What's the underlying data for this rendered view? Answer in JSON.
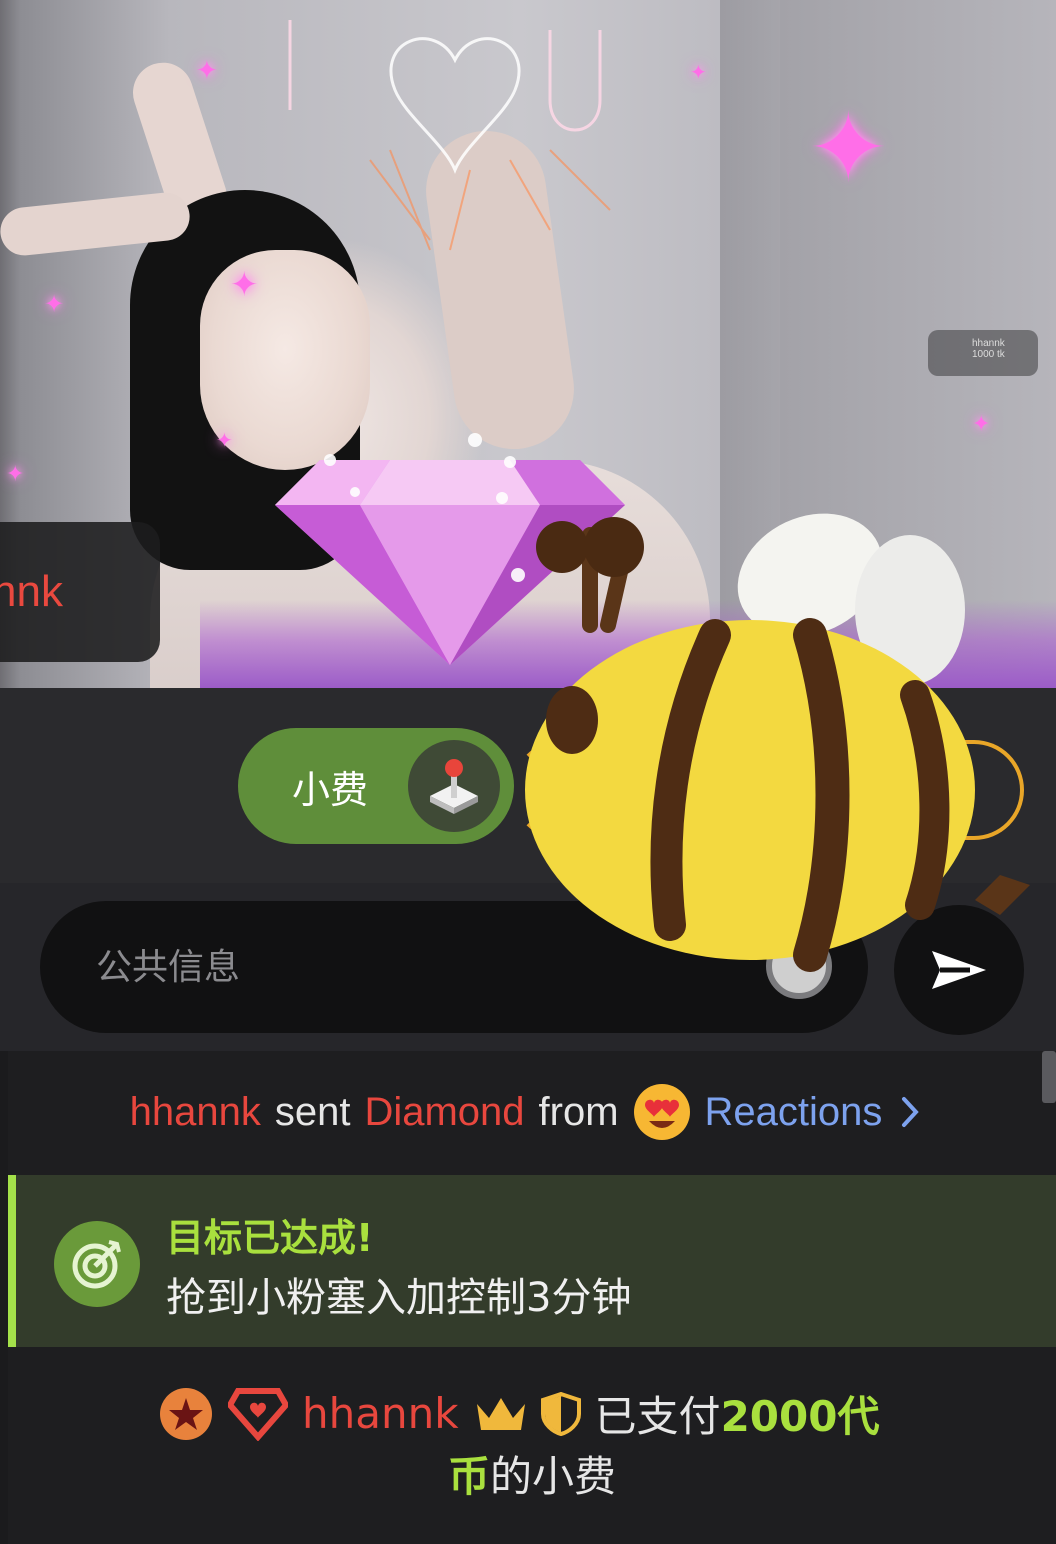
{
  "stream": {
    "user_tag_fragment": "nnk",
    "mini_card": {
      "user": "hhannk",
      "line2": "1000 tk"
    }
  },
  "controls": {
    "tip_button_label": "小费",
    "icons": {
      "tip_button": "joystick-icon",
      "send": "send-arrow-icon",
      "emoji": "emoji-icon"
    }
  },
  "composer": {
    "placeholder": "公共信息"
  },
  "feed": {
    "gift_message": {
      "user": "hhannk",
      "verb": "sent",
      "gift": "Diamond",
      "from_word": "from",
      "source": "Reactions",
      "source_icon": "heart-eyes-emoji-icon",
      "chevron_icon": "chevron-right-icon"
    },
    "goal_message": {
      "title": "目标已达成!",
      "text": "抢到小粉塞入加控制3分钟",
      "icon": "target-icon",
      "accent_color": "#a4e14a"
    },
    "tip_message": {
      "user": "hhannk",
      "prefix": "已支付",
      "amount_part1": "2000代",
      "amount_part2": "币",
      "suffix": "的小费",
      "badges": [
        "star-badge-icon",
        "diamond-heart-badge-icon",
        "crown-icon",
        "shield-icon"
      ]
    }
  },
  "colors": {
    "username": "#e8473e",
    "accent_green": "#a9e03e",
    "link_blue": "#7da2ee",
    "tip_button": "#5f8e3a"
  }
}
